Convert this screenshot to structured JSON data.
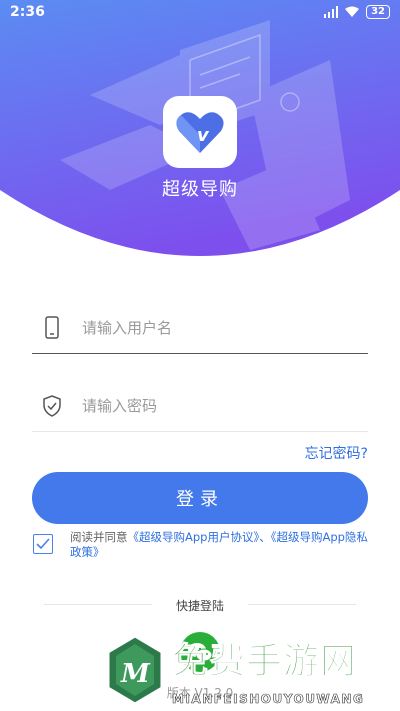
{
  "status_bar": {
    "time": "2:36",
    "battery": "32"
  },
  "header": {
    "app_name": "超级导购",
    "logo_letter": "v"
  },
  "form": {
    "username_placeholder": "请输入用户名",
    "password_placeholder": "请输入密码",
    "forgot_label": "忘记密码?",
    "login_label": "登录"
  },
  "agreement": {
    "prefix": "阅读并同意",
    "user_agreement": "《超级导购App用户协议》",
    "separator": "、",
    "privacy_policy": "《超级导购App隐私政策》",
    "checked": true
  },
  "quick_login": {
    "label": "快捷登陆",
    "wechat_icon": "wechat-icon"
  },
  "version": "版本 V1.2.0",
  "watermark": {
    "title": "免费手游网",
    "subtitle": "MIANFEISHOUYOUWANG"
  },
  "colors": {
    "primary": "#4479ec",
    "link": "#2f6fe0",
    "hero_top": "#5d86f2",
    "hero_bottom": "#7e52ee",
    "wechat": "#2aae3a"
  }
}
